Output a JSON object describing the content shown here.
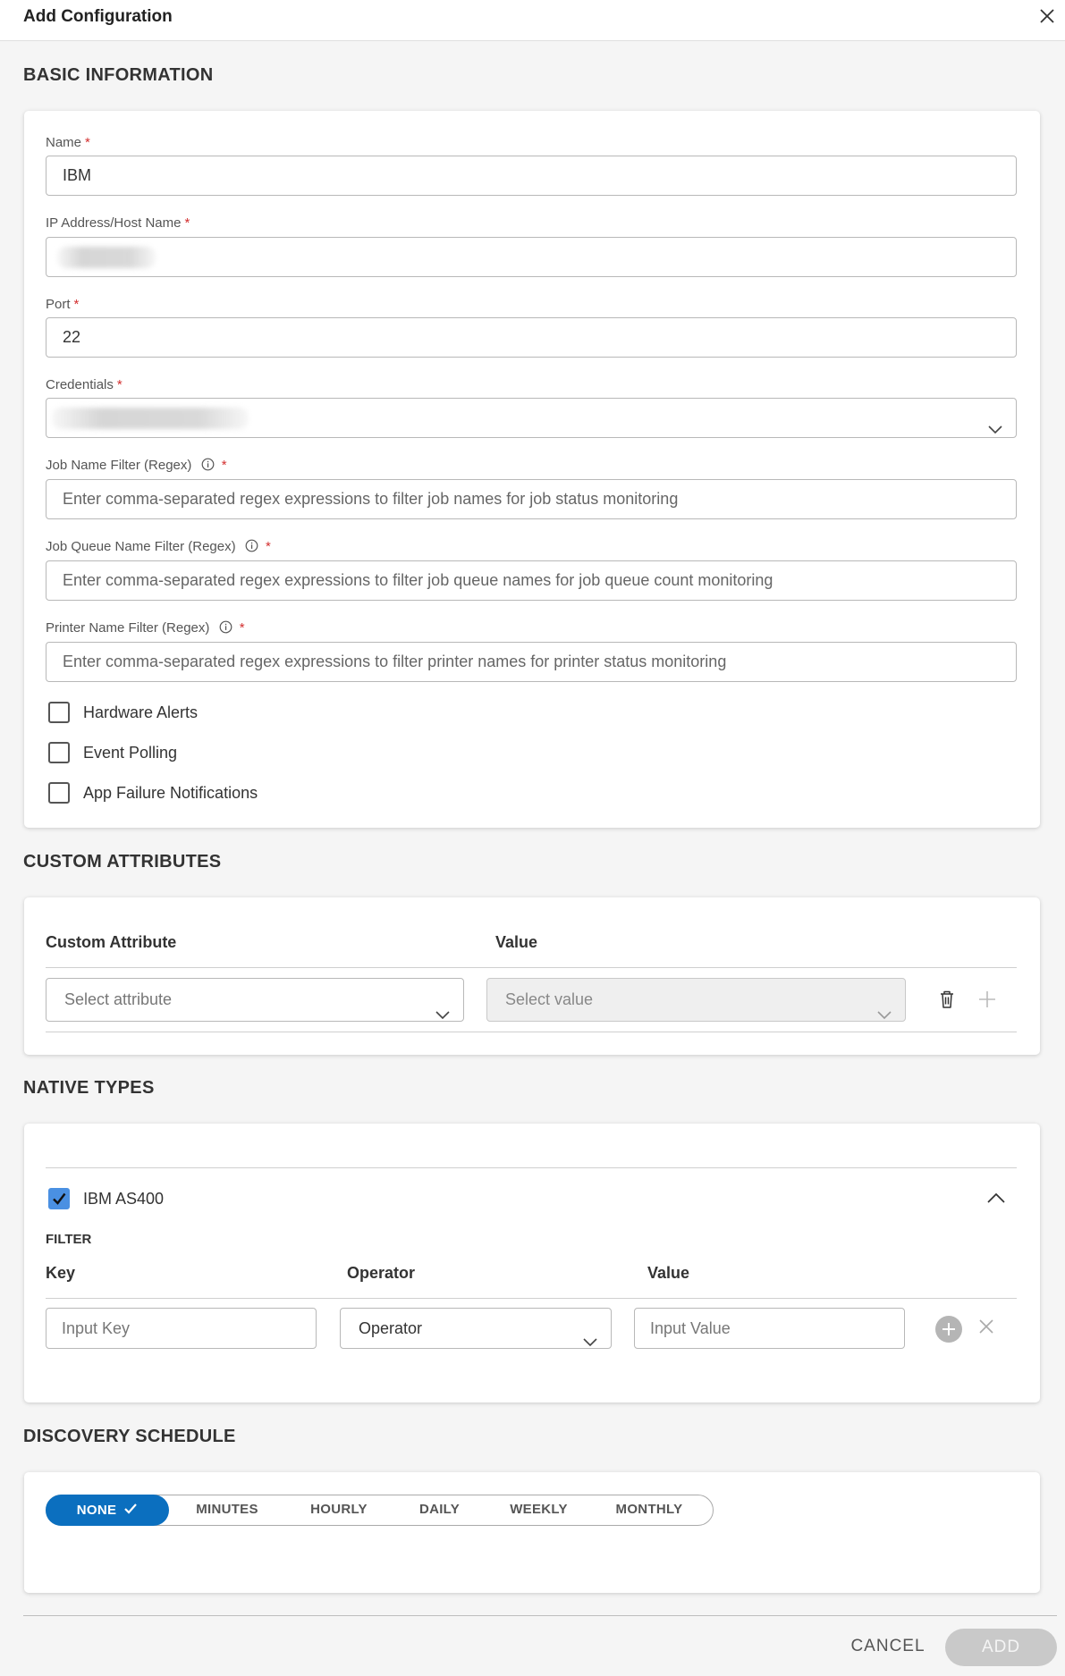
{
  "header": {
    "title": "Add Configuration"
  },
  "basic": {
    "section_title": "BASIC INFORMATION",
    "name": {
      "label": "Name",
      "value": "IBM"
    },
    "host": {
      "label": "IP Address/Host Name"
    },
    "port": {
      "label": "Port",
      "value": "22"
    },
    "credentials": {
      "label": "Credentials"
    },
    "job_name_filter": {
      "label": "Job Name Filter (Regex)",
      "placeholder": "Enter comma-separated regex expressions to filter job names for job status monitoring"
    },
    "job_queue_filter": {
      "label": "Job Queue Name Filter (Regex)",
      "placeholder": "Enter comma-separated regex expressions to filter job queue names for job queue count monitoring"
    },
    "printer_filter": {
      "label": "Printer Name Filter (Regex)",
      "placeholder": "Enter comma-separated regex expressions to filter printer names for printer status monitoring"
    },
    "required_mark": "*",
    "checkboxes": [
      {
        "label": "Hardware Alerts",
        "checked": false
      },
      {
        "label": "Event Polling",
        "checked": false
      },
      {
        "label": "App Failure Notifications",
        "checked": false
      }
    ]
  },
  "custom": {
    "section_title": "CUSTOM ATTRIBUTES",
    "col_attribute": "Custom Attribute",
    "col_value": "Value",
    "attribute_placeholder": "Select attribute",
    "value_placeholder": "Select value"
  },
  "native": {
    "section_title": "NATIVE TYPES",
    "type_label": "IBM AS400",
    "type_checked": true,
    "filter_heading": "FILTER",
    "col_key": "Key",
    "col_operator": "Operator",
    "col_value": "Value",
    "key_placeholder": "Input Key",
    "operator_selected": "Operator",
    "value_placeholder": "Input Value"
  },
  "schedule": {
    "section_title": "DISCOVERY SCHEDULE",
    "options": [
      "NONE",
      "MINUTES",
      "HOURLY",
      "DAILY",
      "WEEKLY",
      "MONTHLY"
    ],
    "selected": "NONE"
  },
  "footer": {
    "cancel_label": "CANCEL",
    "add_label": "ADD"
  },
  "colors": {
    "accent": "#0b6fbf",
    "required": "#d32f2f",
    "disabled": "#c9c9c9"
  }
}
